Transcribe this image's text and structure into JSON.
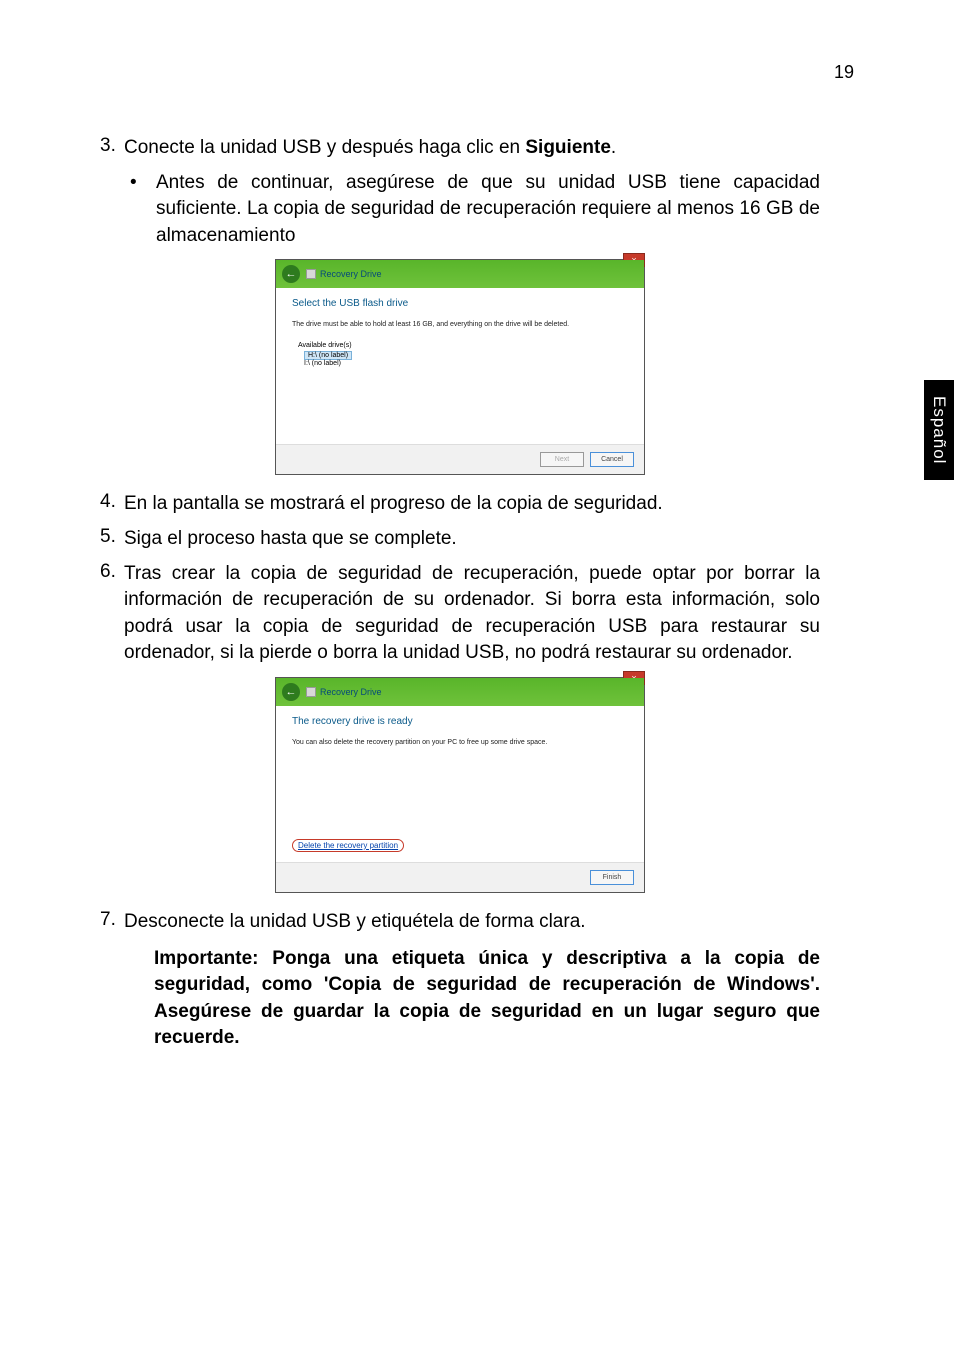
{
  "page_number": "19",
  "side_tab": "Español",
  "steps": {
    "s3_num": "3.",
    "s3_text_a": "Conecte la unidad USB y después haga clic en ",
    "s3_text_b": "Siguiente",
    "s3_text_c": ".",
    "s3_bullet_dot": "•",
    "s3_bullet": "Antes de continuar, asegúrese de que su unidad USB tiene capacidad suficiente. La copia de seguridad de recuperación requiere al menos 16 GB de almacenamiento",
    "s4_num": "4.",
    "s4_text": "En la pantalla se mostrará el progreso de la copia de seguridad.",
    "s5_num": "5.",
    "s5_text": "Siga el proceso hasta que se complete.",
    "s6_num": "6.",
    "s6_text": "Tras crear la copia de seguridad de recuperación, puede optar por borrar la información de recuperación de su ordenador. Si borra esta información, solo podrá usar la copia de seguridad de recuperación USB para restaurar su ordenador, si la pierde o borra la unidad USB, no podrá restaurar su ordenador.",
    "s7_num": "7.",
    "s7_text": "Desconecte la unidad USB y etiquétela de forma clara.",
    "important": "Importante: Ponga una etiqueta única y descriptiva a la copia de seguridad, como 'Copia de seguridad de recuperación de Windows'. Asegúrese de guardar la copia de seguridad en un lugar seguro que recuerde."
  },
  "dialog1": {
    "title": "Recovery Drive",
    "back": "←",
    "close": "×",
    "heading": "Select the USB flash drive",
    "text": "The drive must be able to hold at least 16 GB, and everything on the drive will be deleted.",
    "avail": "Available drive(s)",
    "d1": "H:\\ (no label)",
    "d2": "I:\\ (no label)",
    "next": "Next",
    "cancel": "Cancel"
  },
  "dialog2": {
    "title": "Recovery Drive",
    "back": "←",
    "close": "×",
    "heading": "The recovery drive is ready",
    "text": "You can also delete the recovery partition on your PC to free up some drive space.",
    "delete_link": "Delete the recovery partition",
    "finish": "Finish"
  }
}
